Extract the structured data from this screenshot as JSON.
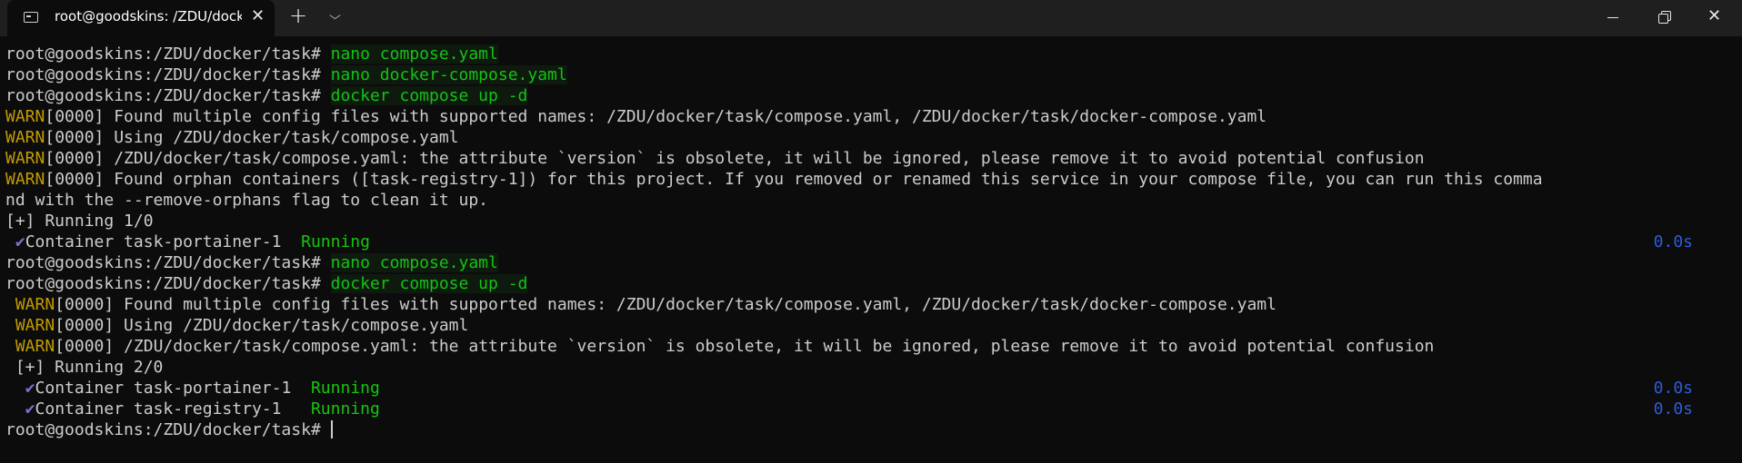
{
  "window": {
    "tab_title": "root@goodskins: /ZDU/docke",
    "tab_icon": "terminal-icon",
    "new_tab_label": "+",
    "dropdown_icon": "chevron-down-icon",
    "close_tab_label": "✕",
    "close_window_label": "✕"
  },
  "colors": {
    "background": "#0c0c0c",
    "command": "#13c313",
    "warn": "#c19c00",
    "running": "#16c60c",
    "duration": "#2f5bd9",
    "checkmark": "#8a6bd6"
  },
  "terminal": {
    "prompt": "root@goodskins:/ZDU/docker/task#",
    "lines": [
      {
        "type": "cmd",
        "command": "nano compose.yaml"
      },
      {
        "type": "cmd",
        "command": "nano docker-compose.yaml"
      },
      {
        "type": "cmd",
        "command": "docker compose up -d"
      },
      {
        "type": "warn",
        "level": "WARN",
        "text": "[0000] Found multiple config files with supported names: /ZDU/docker/task/compose.yaml, /ZDU/docker/task/docker-compose.yaml"
      },
      {
        "type": "warn",
        "level": "WARN",
        "text": "[0000] Using /ZDU/docker/task/compose.yaml"
      },
      {
        "type": "warn",
        "level": "WARN",
        "text": "[0000] /ZDU/docker/task/compose.yaml: the attribute `version` is obsolete, it will be ignored, please remove it to avoid potential confusion"
      },
      {
        "type": "warn",
        "level": "WARN",
        "text": "[0000] Found orphan containers ([task-registry-1]) for this project. If you removed or renamed this service in your compose file, you can run this comma"
      },
      {
        "type": "text",
        "text": "nd with the --remove-orphans flag to clean it up."
      },
      {
        "type": "text",
        "text": "[+] Running 1/0"
      },
      {
        "type": "container",
        "indent": " ",
        "check": "✔",
        "name": "Container task-portainer-1  ",
        "status": "Running",
        "duration": "0.0s"
      },
      {
        "type": "cmd",
        "command": "nano compose.yaml"
      },
      {
        "type": "cmd",
        "command": "docker compose up -d"
      },
      {
        "type": "warn",
        "indent": " ",
        "level": "WARN",
        "text": "[0000] Found multiple config files with supported names: /ZDU/docker/task/compose.yaml, /ZDU/docker/task/docker-compose.yaml"
      },
      {
        "type": "warn",
        "indent": " ",
        "level": "WARN",
        "text": "[0000] Using /ZDU/docker/task/compose.yaml"
      },
      {
        "type": "warn",
        "indent": " ",
        "level": "WARN",
        "text": "[0000] /ZDU/docker/task/compose.yaml: the attribute `version` is obsolete, it will be ignored, please remove it to avoid potential confusion"
      },
      {
        "type": "text",
        "text": " [+] Running 2/0"
      },
      {
        "type": "container",
        "indent": "  ",
        "check": "✔",
        "name": "Container task-portainer-1  ",
        "status": "Running",
        "duration": "0.0s"
      },
      {
        "type": "container",
        "indent": "  ",
        "check": "✔",
        "name": "Container task-registry-1   ",
        "status": "Running",
        "duration": "0.0s"
      },
      {
        "type": "prompt_active"
      }
    ]
  }
}
